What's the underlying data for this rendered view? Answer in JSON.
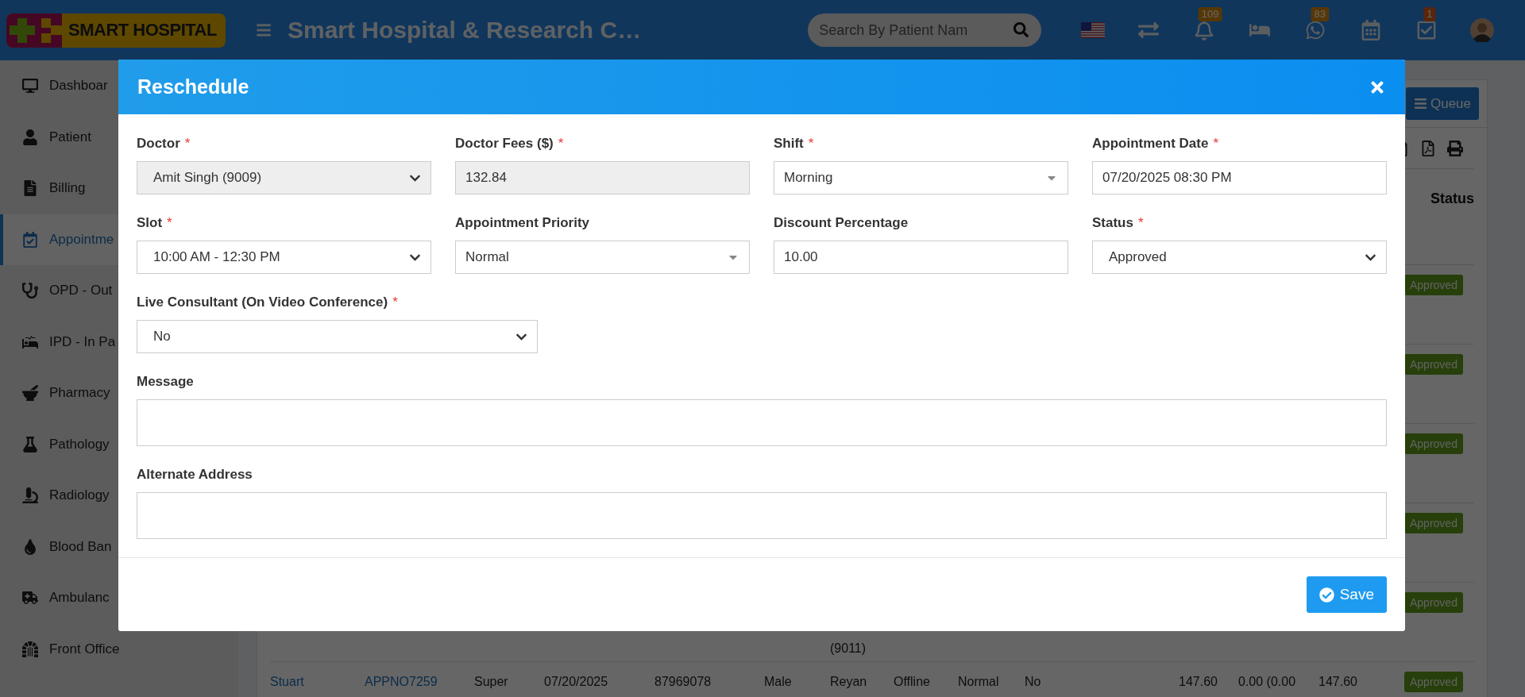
{
  "header": {
    "logo_text": "SMART HOSPITAL",
    "title": "Smart Hospital & Research C…",
    "search": {
      "placeholder": "Search By Patient Nam"
    },
    "toolbar": [
      {
        "kind": "flag"
      },
      {
        "kind": "transfer"
      },
      {
        "kind": "bell",
        "badge": "109"
      },
      {
        "kind": "bed"
      },
      {
        "kind": "chat",
        "badge": "83"
      },
      {
        "kind": "calendar"
      },
      {
        "kind": "tasks",
        "badge": "1"
      },
      {
        "kind": "avatar"
      }
    ]
  },
  "sidebar": {
    "items": [
      {
        "label": "Dashboar",
        "selected": false
      },
      {
        "label": "Patient",
        "selected": false
      },
      {
        "label": "Billing",
        "selected": false
      },
      {
        "label": "Appointme",
        "selected": true
      },
      {
        "label": "OPD - Out",
        "selected": false
      },
      {
        "label": "IPD - In Pa",
        "selected": false
      },
      {
        "label": "Pharmacy",
        "selected": false
      },
      {
        "label": "Pathology",
        "selected": false
      },
      {
        "label": "Radiology",
        "selected": false
      },
      {
        "label": "Blood Ban",
        "selected": false
      },
      {
        "label": "Ambulanc",
        "selected": false
      },
      {
        "label": "Front Office",
        "selected": false
      }
    ]
  },
  "content": {
    "queue_button": "Queue",
    "status_heading": "Status",
    "rows": [
      {
        "status": "Approved"
      },
      {
        "status": "Approved"
      },
      {
        "status": "Approved"
      },
      {
        "status": "Approved"
      },
      {
        "column_7": "(9011)",
        "status": "Approved"
      },
      {
        "column_1": "Stuart",
        "column_2": "APPNO7259",
        "column_3": "Super",
        "column_4": "07/20/2025",
        "column_5": "87969078",
        "column_6": "Male",
        "column_7": "Reyan",
        "column_8": "Offline",
        "column_9": "Normal",
        "column_10": "No",
        "column_11": "147.60",
        "column_12": "0.00 (0.00",
        "column_13": "147.60",
        "status": "Approved"
      }
    ]
  },
  "modal": {
    "title": "Reschedule",
    "field_rows": [
      [
        {
          "label": "Doctor",
          "required_mark": "*",
          "kind": "select",
          "value": "Amit Singh (9009)",
          "disabled": true
        },
        {
          "label": "Doctor Fees ($)",
          "required_mark": "*",
          "kind": "input",
          "value": "132.84",
          "disabled": true
        },
        {
          "label": "Shift",
          "required_mark": "*",
          "kind": "dropdown",
          "value": "Morning",
          "disabled": false
        },
        {
          "label": "Appointment Date",
          "required_mark": "*",
          "kind": "input",
          "value": "07/20/2025 08:30 PM",
          "disabled": false
        }
      ],
      [
        {
          "label": "Slot",
          "required_mark": "*",
          "kind": "select",
          "value": "10:00 AM - 12:30 PM",
          "disabled": false
        },
        {
          "label": "Appointment Priority",
          "kind": "dropdown",
          "value": "Normal",
          "disabled": false
        },
        {
          "label": "Discount Percentage",
          "kind": "input",
          "value": "10.00",
          "disabled": false
        },
        {
          "label": "Status",
          "required_mark": "*",
          "kind": "select",
          "value": "Approved",
          "disabled": false
        }
      ],
      [
        {
          "label": "Live Consultant (On Video Conference)",
          "required_mark": "*",
          "kind": "select",
          "value": "No",
          "disabled": false
        }
      ],
      [
        {
          "label": "Message",
          "kind": "textarea",
          "disabled": false
        }
      ],
      [
        {
          "label": "Alternate Address",
          "kind": "textarea",
          "disabled": false
        }
      ]
    ],
    "save_button": "Save"
  }
}
